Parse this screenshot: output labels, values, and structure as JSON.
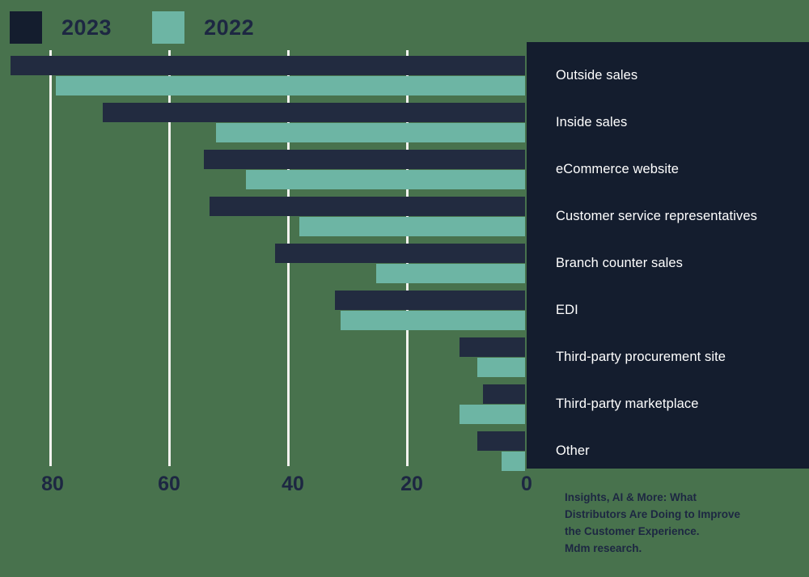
{
  "legend": {
    "entries": [
      {
        "label": "2023",
        "color": "#141d2e",
        "swatch_icon": "legend-swatch-2023"
      },
      {
        "label": "2022",
        "color": "#6db5a4",
        "swatch_icon": "legend-swatch-2022"
      }
    ]
  },
  "axis": {
    "ticks": [
      "80",
      "60",
      "40",
      "20",
      "0"
    ]
  },
  "source": {
    "line1": "Insights, AI & More: What",
    "line2": "Distributors Are Doing to Improve",
    "line3": "the Customer Experience.",
    "line4": "Mdm research."
  },
  "colors": {
    "background": "#48724d",
    "panel": "#141d2e",
    "series_2023": "#222b40",
    "series_2022": "#6db5a4",
    "gridline": "#f2f2ee",
    "tick_text": "#1d2742",
    "panel_text": "#ffffff"
  },
  "labels": [
    "Outside sales",
    "Inside sales",
    "eCommerce website",
    "Customer service representatives",
    "Branch counter sales",
    "EDI",
    "Third-party procurement site",
    "Third-party marketplace",
    "Other"
  ],
  "chart_data": {
    "type": "bar",
    "orientation": "horizontal",
    "title": "",
    "subtitle": "",
    "xlabel": "",
    "ylabel": "",
    "xlim": [
      0,
      88
    ],
    "x_axis_reversed": true,
    "grid": true,
    "gridlines_at": [
      80,
      60,
      40,
      20
    ],
    "legend_position": "top-left",
    "categories": [
      "Outside sales",
      "Inside sales",
      "eCommerce website",
      "Customer service representatives",
      "Branch counter sales",
      "EDI",
      "Third-party procurement site",
      "Third-party marketplace",
      "Other"
    ],
    "series": [
      {
        "name": "2023",
        "color": "#222b40",
        "values": [
          87,
          71,
          54,
          53,
          42,
          32,
          11,
          7,
          8
        ]
      },
      {
        "name": "2022",
        "color": "#6db5a4",
        "values": [
          79,
          52,
          47,
          38,
          25,
          31,
          8,
          11,
          4
        ]
      }
    ],
    "tick_labels": [
      "80",
      "60",
      "40",
      "20",
      "0"
    ],
    "source_note": "Insights, AI & More: What Distributors Are Doing to Improve the Customer Experience. Mdm research."
  }
}
